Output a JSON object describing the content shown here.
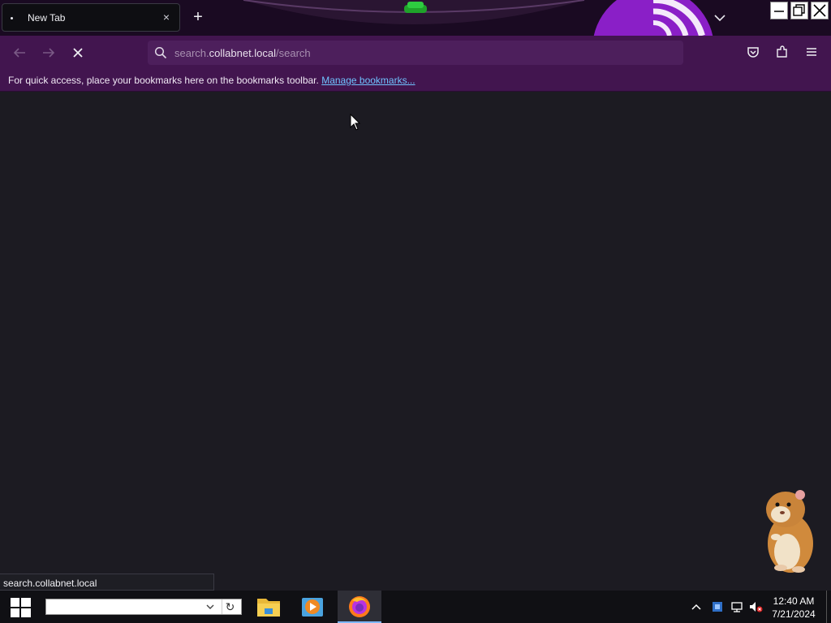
{
  "browser": {
    "tab": {
      "title": "New Tab",
      "close_glyph": "×"
    },
    "new_tab_glyph": "+",
    "url": {
      "prefix": "search.",
      "host": "collabnet.local",
      "path": "/search"
    },
    "bookmarks_bar": {
      "message": "For quick access, place your bookmarks here on the bookmarks toolbar.",
      "link": "Manage bookmarks..."
    },
    "status_text": "search.collabnet.local"
  },
  "taskbar": {
    "search_refresh_glyph": "↻",
    "clock": {
      "time": "12:40 AM",
      "date": "7/21/2024"
    }
  },
  "colors": {
    "toolbar": "#42154f",
    "content_bg": "#1c1b22",
    "theme_accent": "#8a1fc7",
    "link": "#6fc3ff"
  },
  "icons": [
    "back-arrow-icon",
    "forward-arrow-icon",
    "stop-icon",
    "search-icon",
    "pocket-icon",
    "extensions-icon",
    "menu-icon",
    "windows-logo-icon",
    "file-explorer-icon",
    "media-player-icon",
    "firefox-icon",
    "chevron-up-icon",
    "shield-icon",
    "network-icon",
    "speaker-muted-icon"
  ]
}
